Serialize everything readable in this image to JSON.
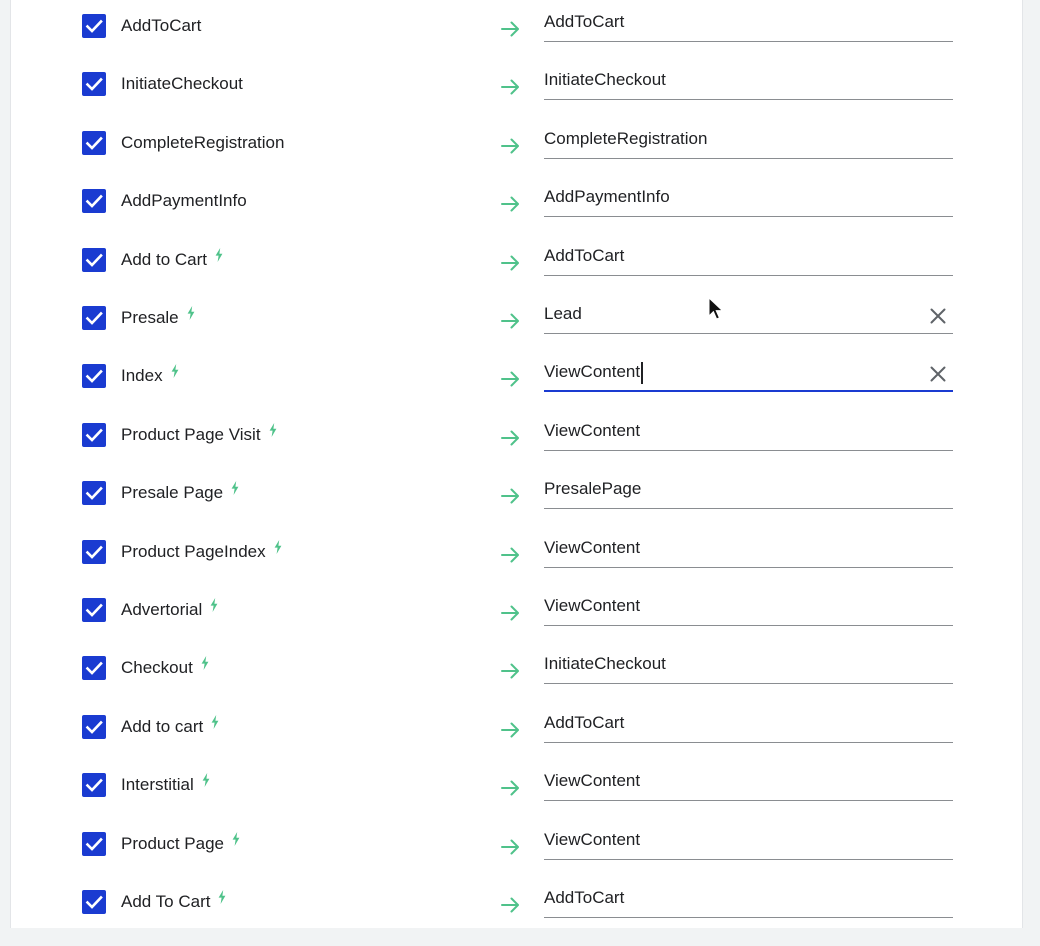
{
  "colors": {
    "checkbox": "#1a3bd1",
    "arrow": "#4fc28a",
    "bolt": "#4fc28a",
    "focus_underline": "#1a3bd1"
  },
  "mappings": [
    {
      "source": "AddToCart",
      "target": "AddToCart",
      "checked": true,
      "bolt": false
    },
    {
      "source": "InitiateCheckout",
      "target": "InitiateCheckout",
      "checked": true,
      "bolt": false
    },
    {
      "source": "CompleteRegistration",
      "target": "CompleteRegistration",
      "checked": true,
      "bolt": false
    },
    {
      "source": "AddPaymentInfo",
      "target": "AddPaymentInfo",
      "checked": true,
      "bolt": false
    },
    {
      "source": "Add to Cart",
      "target": "AddToCart",
      "checked": true,
      "bolt": true
    },
    {
      "source": "Presale",
      "target": "Lead",
      "checked": true,
      "bolt": true,
      "clearable": true
    },
    {
      "source": "Index",
      "target": "ViewContent",
      "checked": true,
      "bolt": true,
      "clearable": true,
      "focused": true
    },
    {
      "source": "Product Page Visit",
      "target": "ViewContent",
      "checked": true,
      "bolt": true
    },
    {
      "source": "Presale Page",
      "target": "PresalePage",
      "checked": true,
      "bolt": true
    },
    {
      "source": "Product PageIndex",
      "target": "ViewContent",
      "checked": true,
      "bolt": true
    },
    {
      "source": "Advertorial",
      "target": "ViewContent",
      "checked": true,
      "bolt": true
    },
    {
      "source": "Checkout",
      "target": "InitiateCheckout",
      "checked": true,
      "bolt": true
    },
    {
      "source": "Add to cart",
      "target": "AddToCart",
      "checked": true,
      "bolt": true
    },
    {
      "source": "Interstitial",
      "target": "ViewContent",
      "checked": true,
      "bolt": true
    },
    {
      "source": "Product Page",
      "target": "ViewContent",
      "checked": true,
      "bolt": true
    },
    {
      "source": "Add To Cart",
      "target": "AddToCart",
      "checked": true,
      "bolt": true
    }
  ]
}
